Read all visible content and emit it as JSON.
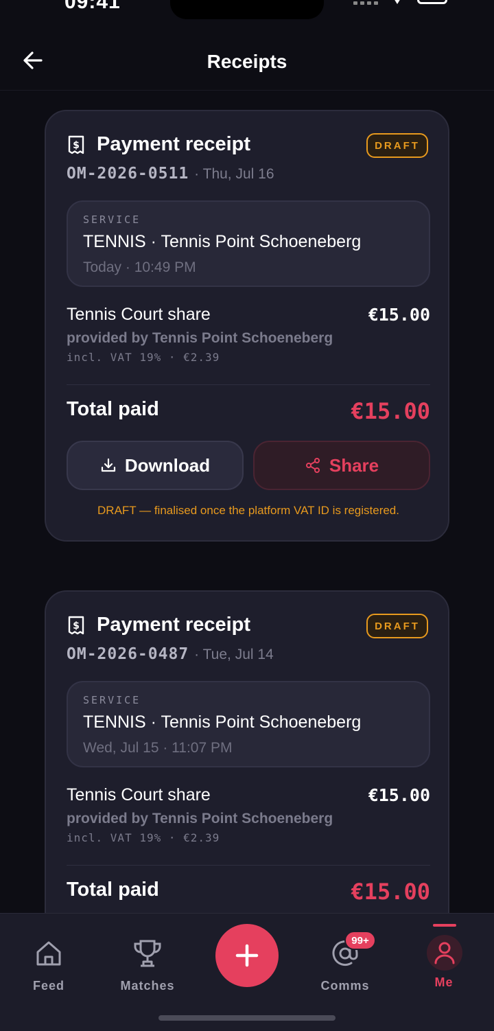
{
  "status_bar": {
    "time": "09:41"
  },
  "header": {
    "title": "Receipts"
  },
  "receipts": [
    {
      "title": "Payment receipt",
      "badge": "DRAFT",
      "number": "OM-2026-0511",
      "date": "· Thu, Jul 16",
      "service_label": "SERVICE",
      "service_name": "TENNIS · Tennis Point Schoeneberg",
      "service_time": "Today · 10:49 PM",
      "item": "Tennis Court share",
      "item_price": "€15.00",
      "provider": "provided by Tennis Point Schoeneberg",
      "vat": "incl. VAT 19% · €2.39",
      "total_label": "Total paid",
      "total_value": "€15.00",
      "download_label": "Download",
      "share_label": "Share",
      "note": "DRAFT — finalised once the platform VAT ID is registered."
    },
    {
      "title": "Payment receipt",
      "badge": "DRAFT",
      "number": "OM-2026-0487",
      "date": "· Tue, Jul 14",
      "service_label": "SERVICE",
      "service_name": "TENNIS · Tennis Point Schoeneberg",
      "service_time": "Wed, Jul 15 · 11:07 PM",
      "item": "Tennis Court share",
      "item_price": "€15.00",
      "provider": "provided by Tennis Point Schoeneberg",
      "vat": "incl. VAT 19% · €2.39",
      "total_label": "Total paid",
      "total_value": "€15.00"
    }
  ],
  "tabbar": {
    "feed": "Feed",
    "matches": "Matches",
    "comms": "Comms",
    "comms_badge": "99+",
    "me": "Me",
    "active": "Me"
  },
  "colors": {
    "accent": "#e5405e",
    "draft": "#e89a1e",
    "background": "#0d0d14",
    "card": "#1e1e2c"
  }
}
